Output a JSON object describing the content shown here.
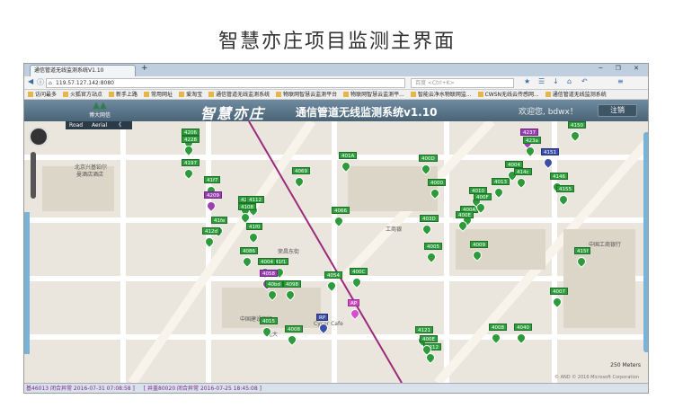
{
  "page_title": "智慧亦庄项目监测主界面",
  "browser": {
    "tab_title": "通信管道无线监测系统V1.10",
    "new_tab": "+",
    "url": "119.57.127.142:8080",
    "search_placeholder": "百度 <Ctrl+K>",
    "bookmarks": [
      "访问最多",
      "火狐官方站点",
      "新手上路",
      "常用网址",
      "爱淘宝",
      "通信管道无线监测系统",
      "物联网智慧云监测平台",
      "物联网智慧云监测平...",
      "智能云净水物联网监...",
      "CWSN无线云传感网...",
      "通信管道无线监测系统"
    ]
  },
  "app": {
    "logo_text": "博大网信",
    "brand": "智慧亦庄",
    "system_title": "通信管道无线监测系统v1.10",
    "welcome": "欢迎您, bdwx！",
    "logout": "注销"
  },
  "map": {
    "type_road": "Road",
    "type_aerial": "Aerial",
    "type_collapse": "《",
    "scale": "250 Meters",
    "copyright": "© AND © 2016 Microsoft Corporation",
    "labels": [
      "北京兴基铂尔",
      "曼酒店酒店",
      "荣昌东街",
      "中国建设银行",
      "Cycer Cafe",
      "光大",
      "中国工商银行",
      "工商银"
    ],
    "markers": [
      {
        "id": "4206",
        "color": "green"
      },
      {
        "id": "4228",
        "color": "green"
      },
      {
        "id": "4197",
        "color": "green"
      },
      {
        "id": "41f7",
        "color": "green"
      },
      {
        "id": "4209",
        "color": "purple"
      },
      {
        "id": "4210",
        "color": "green"
      },
      {
        "id": "41fe",
        "color": "green"
      },
      {
        "id": "412d",
        "color": "green"
      },
      {
        "id": "4112",
        "color": "green"
      },
      {
        "id": "4108",
        "color": "green"
      },
      {
        "id": "41f0",
        "color": "green"
      },
      {
        "id": "4086",
        "color": "green"
      },
      {
        "id": "41f1",
        "color": "green"
      },
      {
        "id": "4004",
        "color": "green"
      },
      {
        "id": "4058",
        "color": "purple"
      },
      {
        "id": "40bd",
        "color": "green"
      },
      {
        "id": "4098",
        "color": "green"
      },
      {
        "id": "4015",
        "color": "green"
      },
      {
        "id": "4008",
        "color": "green"
      },
      {
        "id": "4069",
        "color": "green"
      },
      {
        "id": "401A",
        "color": "green"
      },
      {
        "id": "4066",
        "color": "green"
      },
      {
        "id": "4054",
        "color": "green"
      },
      {
        "id": "400C",
        "color": "green"
      },
      {
        "id": "AP",
        "color": "pink"
      },
      {
        "id": "RP",
        "color": "blue"
      },
      {
        "id": "400D",
        "color": "green"
      },
      {
        "id": "4000",
        "color": "green"
      },
      {
        "id": "403D",
        "color": "green"
      },
      {
        "id": "4005",
        "color": "green"
      },
      {
        "id": "400A",
        "color": "green"
      },
      {
        "id": "400E",
        "color": "green"
      },
      {
        "id": "4010",
        "color": "green"
      },
      {
        "id": "400F",
        "color": "green"
      },
      {
        "id": "4013",
        "color": "green"
      },
      {
        "id": "4004b",
        "color": "green"
      },
      {
        "id": "414c",
        "color": "green"
      },
      {
        "id": "4237",
        "color": "purple"
      },
      {
        "id": "423a",
        "color": "green"
      },
      {
        "id": "4151",
        "color": "blue"
      },
      {
        "id": "4150",
        "color": "green"
      },
      {
        "id": "4146",
        "color": "green"
      },
      {
        "id": "4155",
        "color": "green"
      },
      {
        "id": "4009",
        "color": "green"
      },
      {
        "id": "415f",
        "color": "green"
      },
      {
        "id": "4007",
        "color": "green"
      },
      {
        "id": "4008b",
        "color": "green"
      },
      {
        "id": "4040",
        "color": "green"
      },
      {
        "id": "4121",
        "color": "green"
      },
      {
        "id": "4212",
        "color": "green"
      },
      {
        "id": "400E2",
        "color": "green"
      }
    ]
  },
  "status": {
    "text1": "基46013 闭合异常 2016-07-31 07:08:58 ]",
    "text2": "[ 井盖80020 闭合异常 2016-07-25 18:45:08 ]"
  },
  "colors": {
    "header_bg": "#567184",
    "marker_green": "#2d9a3b",
    "marker_purple": "#9c3fb3",
    "status_text": "#7a2a8a"
  }
}
